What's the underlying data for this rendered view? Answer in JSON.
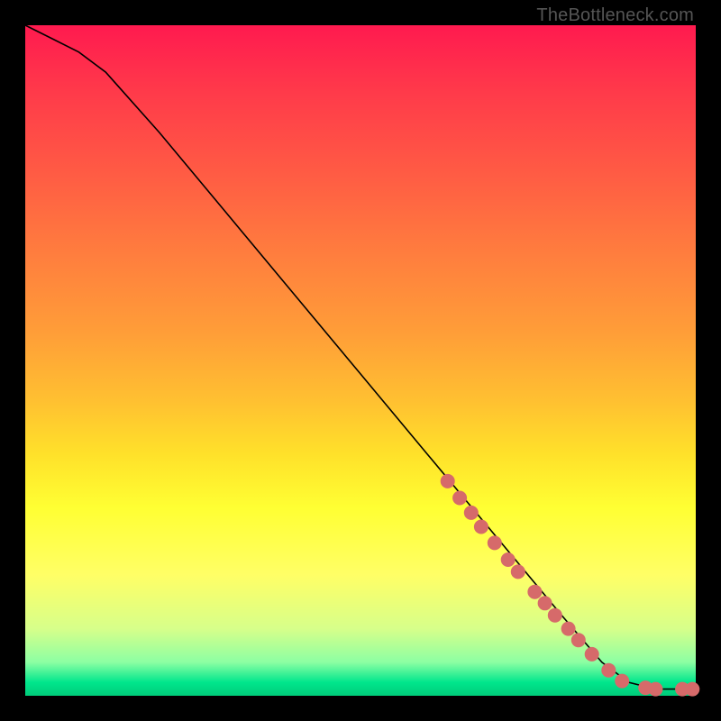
{
  "watermark": "TheBottleneck.com",
  "chart_data": {
    "type": "line",
    "title": "",
    "xlabel": "",
    "ylabel": "",
    "xlim": [
      0,
      100
    ],
    "ylim": [
      0,
      100
    ],
    "grid": false,
    "series": [
      {
        "name": "curve",
        "x": [
          0,
          4,
          8,
          12,
          20,
          30,
          40,
          50,
          60,
          70,
          80,
          86,
          90,
          94,
          98,
          100
        ],
        "y": [
          100,
          98,
          96,
          93,
          84,
          72,
          60,
          48,
          36,
          24,
          12,
          5,
          2,
          1,
          1,
          1
        ]
      }
    ],
    "markers": [
      {
        "x": 63.0,
        "y": 32.0
      },
      {
        "x": 64.8,
        "y": 29.5
      },
      {
        "x": 66.5,
        "y": 27.3
      },
      {
        "x": 68.0,
        "y": 25.2
      },
      {
        "x": 70.0,
        "y": 22.8
      },
      {
        "x": 72.0,
        "y": 20.3
      },
      {
        "x": 73.5,
        "y": 18.5
      },
      {
        "x": 76.0,
        "y": 15.5
      },
      {
        "x": 77.5,
        "y": 13.8
      },
      {
        "x": 79.0,
        "y": 12.0
      },
      {
        "x": 81.0,
        "y": 10.0
      },
      {
        "x": 82.5,
        "y": 8.3
      },
      {
        "x": 84.5,
        "y": 6.2
      },
      {
        "x": 87.0,
        "y": 3.8
      },
      {
        "x": 89.0,
        "y": 2.2
      },
      {
        "x": 92.5,
        "y": 1.2
      },
      {
        "x": 94.0,
        "y": 1.0
      },
      {
        "x": 98.0,
        "y": 1.0
      },
      {
        "x": 99.5,
        "y": 1.0
      }
    ],
    "marker_radius_px": 8,
    "colors": {
      "gradient_top": "#ff1a4f",
      "gradient_mid": "#ffff33",
      "gradient_bottom": "#00cc7a",
      "line": "#000000",
      "marker": "#d66a6a"
    }
  }
}
